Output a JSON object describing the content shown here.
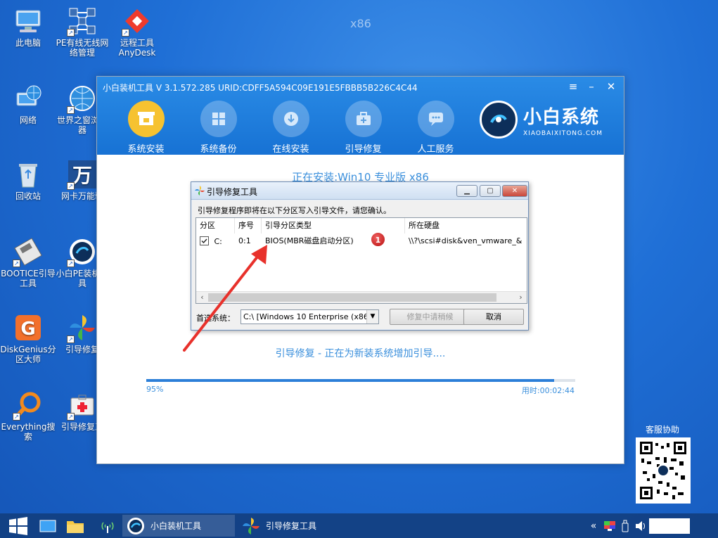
{
  "desktop": {
    "watermark": "x86",
    "icons": [
      {
        "label": "此电脑"
      },
      {
        "label": "PE有线无线网络管理"
      },
      {
        "label": "远程工具AnyDesk"
      },
      {
        "label": "网络"
      },
      {
        "label": "世界之窗浏览器"
      },
      {
        "label": "回收站"
      },
      {
        "label": "网卡万能驱"
      },
      {
        "label": "BOOTICE引导工具"
      },
      {
        "label": "小白PE装机工具"
      },
      {
        "label": "DiskGenius分区大师"
      },
      {
        "label": "引导修复"
      },
      {
        "label": "Everything搜索"
      },
      {
        "label": "引导修复工"
      }
    ]
  },
  "app": {
    "title": "小白装机工具 V 3.1.572.285 URID:CDFF5A594C09E191E5FBBB5B226C4C44",
    "nav": [
      {
        "label": "系统安装",
        "icon": "system-install-icon"
      },
      {
        "label": "系统备份",
        "icon": "system-backup-icon"
      },
      {
        "label": "在线安装",
        "icon": "online-install-icon"
      },
      {
        "label": "引导修复",
        "icon": "boot-repair-icon"
      },
      {
        "label": "人工服务",
        "icon": "chat-service-icon"
      }
    ],
    "brand_cn": "小白系统",
    "brand_en": "XIAOBAIXITONG.COM",
    "install_title": "正在安装:Win10 专业版 x86",
    "status": "引导修复 - 正在为新装系统增加引导....",
    "progress": {
      "percent_label": "95%",
      "value": 0.95,
      "time_label": "用时:00:02:44"
    },
    "accent": "#1f7ad9"
  },
  "dialog": {
    "title": "引导修复工具",
    "message": "引导修复程序即将在以下分区写入引导文件，请您确认。",
    "columns": [
      "分区",
      "序号",
      "引导分区类型",
      "所在硬盘"
    ],
    "rows": [
      {
        "partition": "C:",
        "index": "0:1",
        "type": "BIOS(MBR磁盘启动分区)",
        "disk": "\\\\?\\scsi#disk&ven_vmware_&",
        "checked": true
      }
    ],
    "preferred_label": "首选系统：",
    "preferred_value": "C:\\ [Windows 10 Enterprise (x86",
    "repair_button": "修复中请稍候",
    "cancel_button": "取消",
    "badge": "1"
  },
  "qr": {
    "label": "客服协助"
  },
  "taskbar": {
    "tasks": [
      {
        "label": "小白装机工具"
      },
      {
        "label": "引导修复工具"
      }
    ]
  }
}
